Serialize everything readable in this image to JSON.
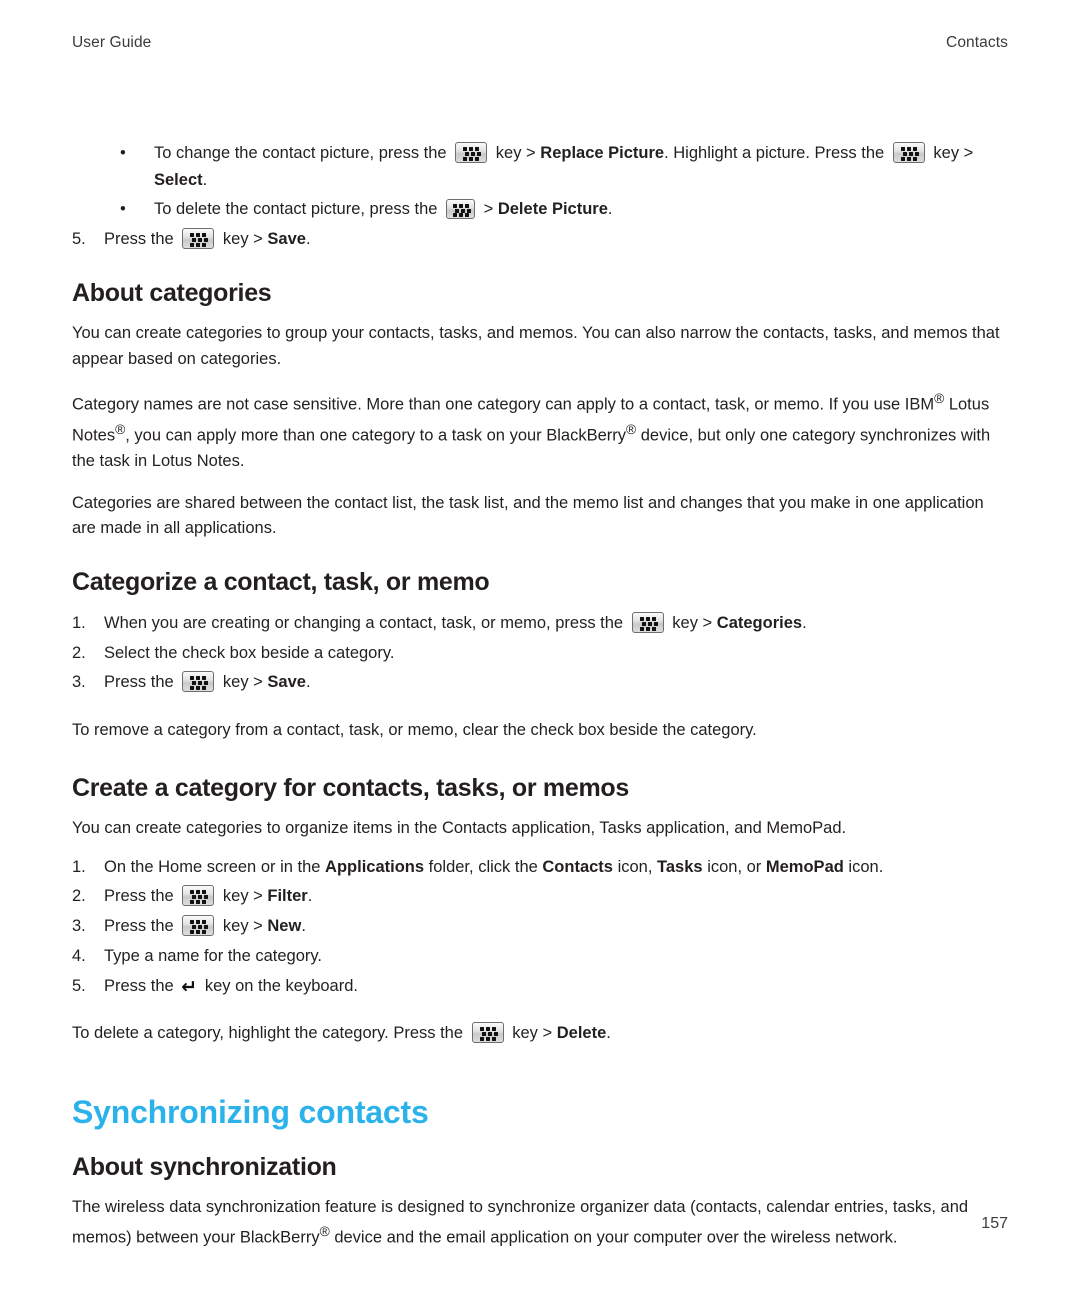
{
  "running_head": {
    "left": "User Guide",
    "right": "Contacts"
  },
  "folio": "157",
  "colors": {
    "chapter_heading": "#2cb2ea",
    "body_text": "#231f20",
    "key_icon_border": "#6e6e6e"
  },
  "icons": {
    "menu_key": "blackberry-menu-key-icon",
    "enter_key": "enter-key-icon",
    "enter_glyph": "↵"
  },
  "continued_steps": {
    "bullets": [
      {
        "pre": "To change the contact picture, press the",
        "mid": "key >",
        "bold1": "Replace Picture",
        "mid2": ". Highlight a picture. Press the",
        "mid3": "key >",
        "bold2": "Select",
        "end": "."
      },
      {
        "pre": "To delete the contact picture, press the",
        "mid": ">",
        "bold1": "Delete Picture",
        "end": "."
      }
    ],
    "step5": {
      "number": "5.",
      "pre": "Press the",
      "mid": "key >",
      "bold": "Save",
      "end": "."
    }
  },
  "about_categories": {
    "heading": "About categories",
    "paragraphs": [
      "You can create categories to group your contacts, tasks, and memos. You can also narrow the contacts, tasks, and memos that appear based on categories.",
      "Categories are shared between the contact list, the task list, and the memo list and changes that you make in one application are made in all applications."
    ],
    "paragraph2": {
      "part1": "Category names are not case sensitive. More than one category can apply to a contact, task, or memo. If you use IBM",
      "sup1": "®",
      "part2": " Lotus Notes",
      "sup2": "®",
      "part3": ", you can apply more than one category to a task on your BlackBerry",
      "sup3": "®",
      "part4": " device, but only one category synchronizes with the task in Lotus Notes."
    }
  },
  "categorize": {
    "heading": "Categorize a contact, task, or memo",
    "steps": [
      {
        "number": "1.",
        "pre": "When you are creating or changing a contact, task, or memo, press the",
        "mid": "key >",
        "bold": "Categories",
        "end": "."
      },
      {
        "number": "2.",
        "pre": "Select the check box beside a category.",
        "mid": "",
        "bold": "",
        "end": ""
      },
      {
        "number": "3.",
        "pre": "Press the",
        "mid": "key >",
        "bold": "Save",
        "end": "."
      }
    ],
    "note": "To remove a category from a contact, task, or memo, clear the check box beside the category."
  },
  "create_category": {
    "heading": "Create a category for contacts, tasks, or memos",
    "intro": "You can create categories to organize items in the Contacts application, Tasks application, and MemoPad.",
    "step1": {
      "number": "1.",
      "part1": "On the Home screen or in the",
      "bold1": "Applications",
      "part2": "folder, click the",
      "bold2": "Contacts",
      "part3": "icon,",
      "bold3": "Tasks",
      "part4": "icon, or",
      "bold4": "MemoPad",
      "part5": "icon."
    },
    "step2": {
      "number": "2.",
      "pre": "Press the",
      "mid": "key >",
      "bold": "Filter",
      "end": "."
    },
    "step3": {
      "number": "3.",
      "pre": "Press the",
      "mid": "key >",
      "bold": "New",
      "end": "."
    },
    "step4": {
      "number": "4.",
      "text": "Type a name for the category."
    },
    "step5": {
      "number": "5.",
      "pre": "Press the",
      "post": "key on the keyboard."
    },
    "note": {
      "pre": "To delete a category, highlight the category. Press the",
      "mid": "key >",
      "bold": "Delete",
      "end": "."
    }
  },
  "synchronizing": {
    "chapter_heading": "Synchronizing contacts",
    "section_heading": "About synchronization",
    "paragraph": {
      "part1": "The wireless data synchronization feature is designed to synchronize organizer data (contacts, calendar entries, tasks, and memos) between your BlackBerry",
      "sup": "®",
      "part2": " device and the email application on your computer over the wireless network."
    }
  }
}
